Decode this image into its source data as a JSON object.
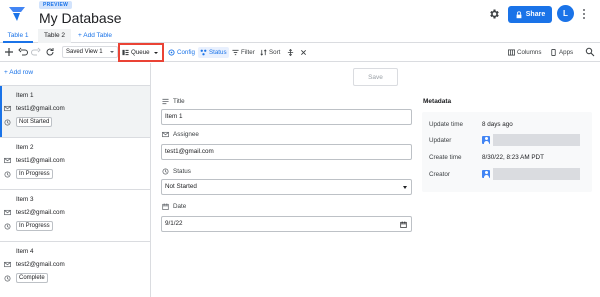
{
  "header": {
    "badge": "PREVIEW",
    "title": "My Database",
    "share_label": "Share",
    "avatar_letter": "L"
  },
  "tabs": [
    {
      "label": "Table 1",
      "active": true
    },
    {
      "label": "Table 2",
      "active": false
    }
  ],
  "add_table_label": "+ Add Table",
  "toolbar": {
    "view_select": "Saved View 1",
    "queue_label": "Queue",
    "config_label": "Config",
    "status_label": "Status",
    "filter_label": "Filter",
    "sort_label": "Sort",
    "columns_label": "Columns",
    "apps_label": "Apps"
  },
  "left": {
    "add_row_label": "+ Add row",
    "items": [
      {
        "name": "Item 1",
        "email": "test1@gmail.com",
        "status": "Not Started",
        "selected": true
      },
      {
        "name": "Item 2",
        "email": "test1@gmail.com",
        "status": "In Progress",
        "selected": false
      },
      {
        "name": "Item 3",
        "email": "test2@gmail.com",
        "status": "In Progress",
        "selected": false
      },
      {
        "name": "Item 4",
        "email": "test2@gmail.com",
        "status": "Complete",
        "selected": false
      }
    ]
  },
  "form": {
    "save_label": "Save",
    "fields": [
      {
        "label": "Title",
        "value": "Item 1"
      },
      {
        "label": "Assignee",
        "value": "test1@gmail.com"
      },
      {
        "label": "Status",
        "value": "Not Started"
      },
      {
        "label": "Date",
        "value": "9/1/22"
      }
    ]
  },
  "metadata": {
    "title": "Metadata",
    "rows": [
      {
        "key": "Update time",
        "value": "8 days ago"
      },
      {
        "key": "Updater",
        "value": ""
      },
      {
        "key": "Create time",
        "value": "8/30/22, 8:23 AM PDT"
      },
      {
        "key": "Creator",
        "value": ""
      }
    ]
  },
  "colors": {
    "accent": "#1a73e8",
    "highlight_box": "#ea4335",
    "selected_row_bg": "#f1f3f4"
  }
}
